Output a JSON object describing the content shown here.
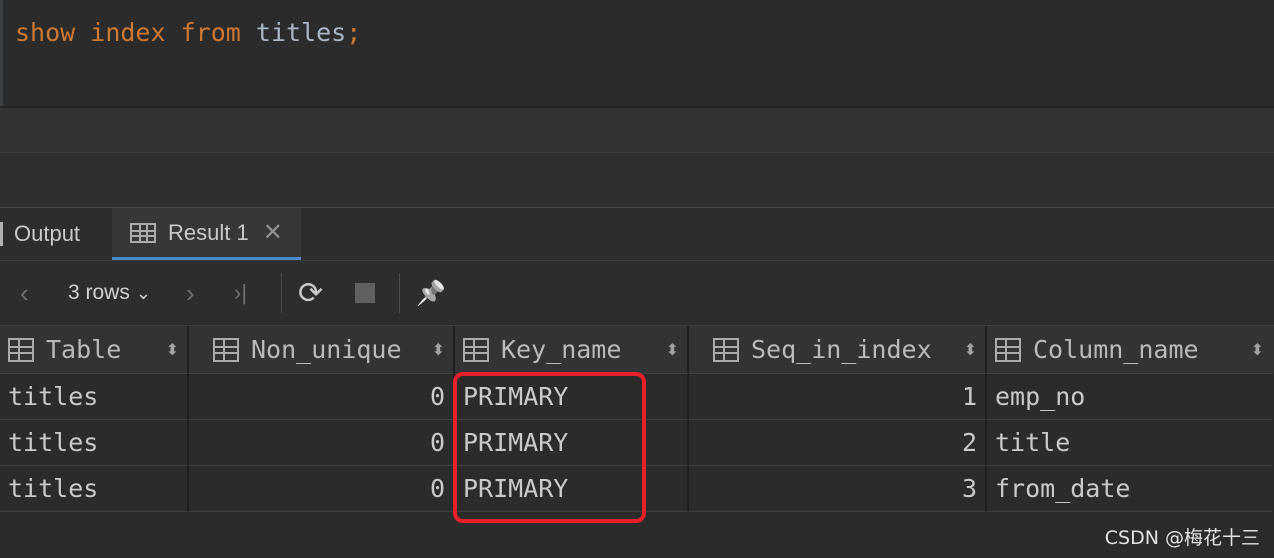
{
  "editor": {
    "kw1": "show",
    "kw2": "index",
    "kw3": "from",
    "ident": "titles",
    "semicolon": ";"
  },
  "tabs": {
    "output_label": "Output",
    "result_label": "Result 1",
    "close_glyph": "✕"
  },
  "toolbar": {
    "prev_glyph": "‹",
    "rows_label": "3 rows",
    "rows_chevron": "⌄",
    "next_glyph": "›",
    "last_glyph": "›|",
    "refresh_glyph": "⟳",
    "pin_glyph": "📌"
  },
  "table": {
    "columns": [
      "Table",
      "Non_unique",
      "Key_name",
      "Seq_in_index",
      "Column_name"
    ],
    "sort_glyph": "⬍",
    "rows": [
      [
        "titles",
        "0",
        "PRIMARY",
        "1",
        "emp_no"
      ],
      [
        "titles",
        "0",
        "PRIMARY",
        "2",
        "title"
      ],
      [
        "titles",
        "0",
        "PRIMARY",
        "3",
        "from_date"
      ]
    ]
  },
  "colors": {
    "keyword": "#cc7832",
    "highlight": "#e8202a",
    "tab_accent": "#4a88c7"
  },
  "watermark": "CSDN @梅花十三"
}
